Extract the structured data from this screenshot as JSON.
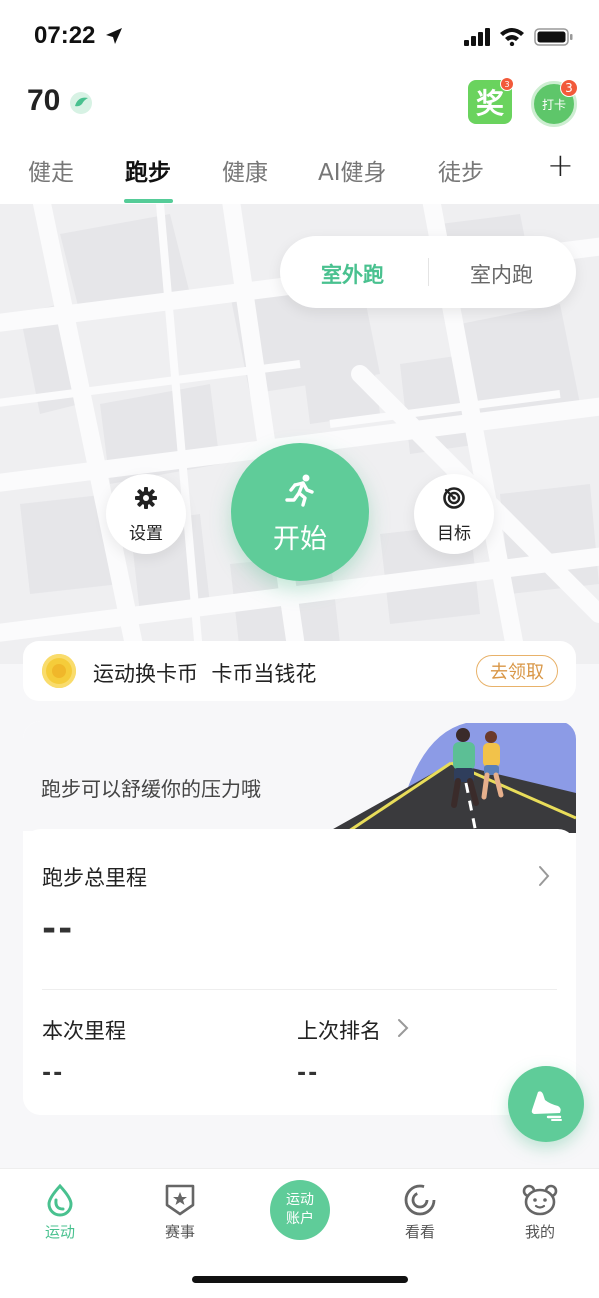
{
  "status_bar": {
    "time": "07:22"
  },
  "header": {
    "score": "70",
    "award_label": "奖",
    "award_badge": "3",
    "checkin_label": "打卡",
    "checkin_badge": "3"
  },
  "tabs": [
    "健走",
    "跑步",
    "健康",
    "AI健身",
    "徒步"
  ],
  "active_tab": "跑步",
  "run_modes": {
    "outdoor": "室外跑",
    "indoor": "室内跑",
    "active": "室外跑"
  },
  "controls": {
    "settings_label": "设置",
    "start_label": "开始",
    "goal_label": "目标"
  },
  "coin_banner": {
    "text": "运动换卡币  卡币当钱花",
    "claim_label": "去领取"
  },
  "stats": {
    "hero_text": "跑步可以舒缓你的压力哦",
    "total_title": "跑步总里程",
    "total_value": "--",
    "current_title": "本次里程",
    "current_value": "--",
    "rank_title": "上次排名",
    "rank_value": "--"
  },
  "bottom_nav": {
    "items": [
      {
        "label": "运动",
        "icon": "drop-icon",
        "active": true
      },
      {
        "label": "赛事",
        "icon": "medal-badge-icon",
        "active": false
      },
      {
        "label": "运动\n账户",
        "icon": "center-button",
        "active": false
      },
      {
        "label": "看看",
        "icon": "swirl-icon",
        "active": false
      },
      {
        "label": "我的",
        "icon": "bear-face-icon",
        "active": false
      }
    ],
    "center_line1": "运动",
    "center_line2": "账户"
  },
  "colors": {
    "accent": "#5fcc99",
    "accent_text": "#49c18f",
    "award_green": "#6ad35e",
    "badge_red": "#f25a3a",
    "claim_orange": "#d99747"
  }
}
